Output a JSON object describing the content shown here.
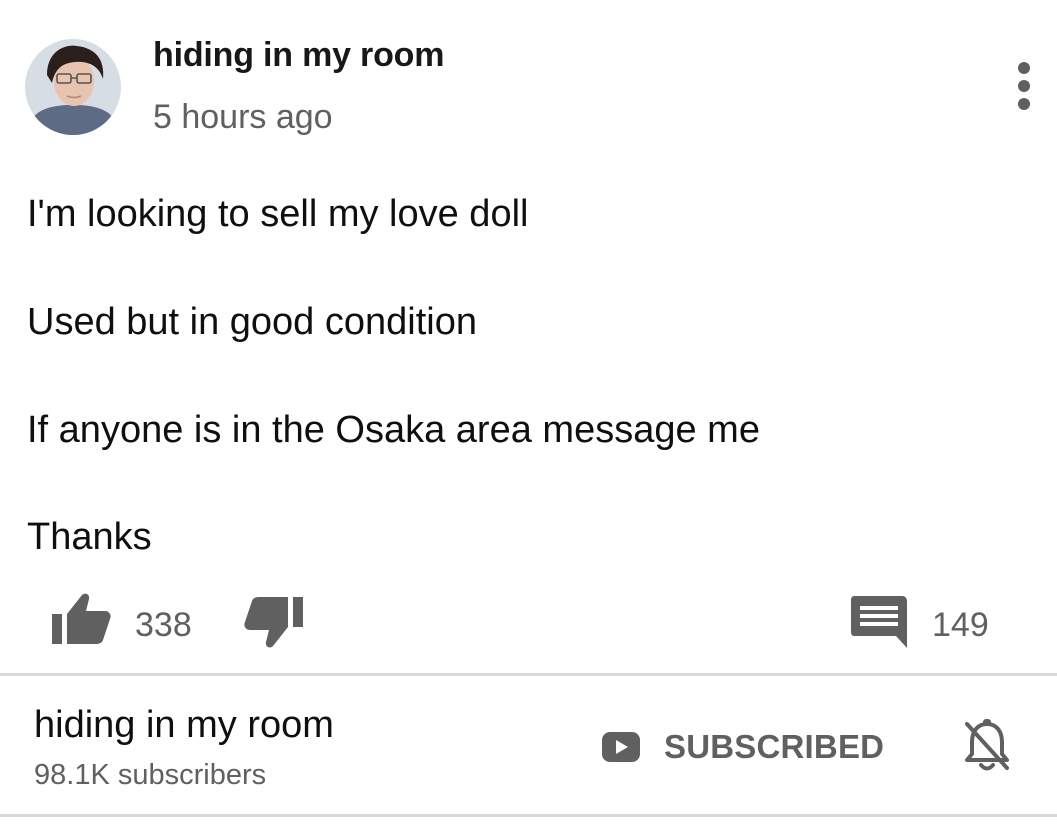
{
  "comment": {
    "author": "hiding in my room",
    "timestamp": "5 hours ago",
    "lines": [
      "I'm looking to sell my love doll",
      "Used but in good condition",
      "If anyone is in the Osaka area message me",
      "Thanks"
    ],
    "likes": "338",
    "replies": "149"
  },
  "channel": {
    "name": "hiding in my room",
    "subscribers": "98.1K subscribers",
    "subscribe_label": "SUBSCRIBED"
  },
  "icons": {
    "avatar": "profile-photo",
    "more": "vertical-ellipsis-icon",
    "like": "thumbs-up-icon",
    "dislike": "thumbs-down-icon",
    "comment": "comment-icon",
    "subscribe": "play-icon",
    "bell": "notifications-off-icon"
  },
  "colors": {
    "text": "#0f0f0f",
    "secondary": "#606060",
    "divider": "#d9d9d9",
    "background": "#ffffff"
  }
}
